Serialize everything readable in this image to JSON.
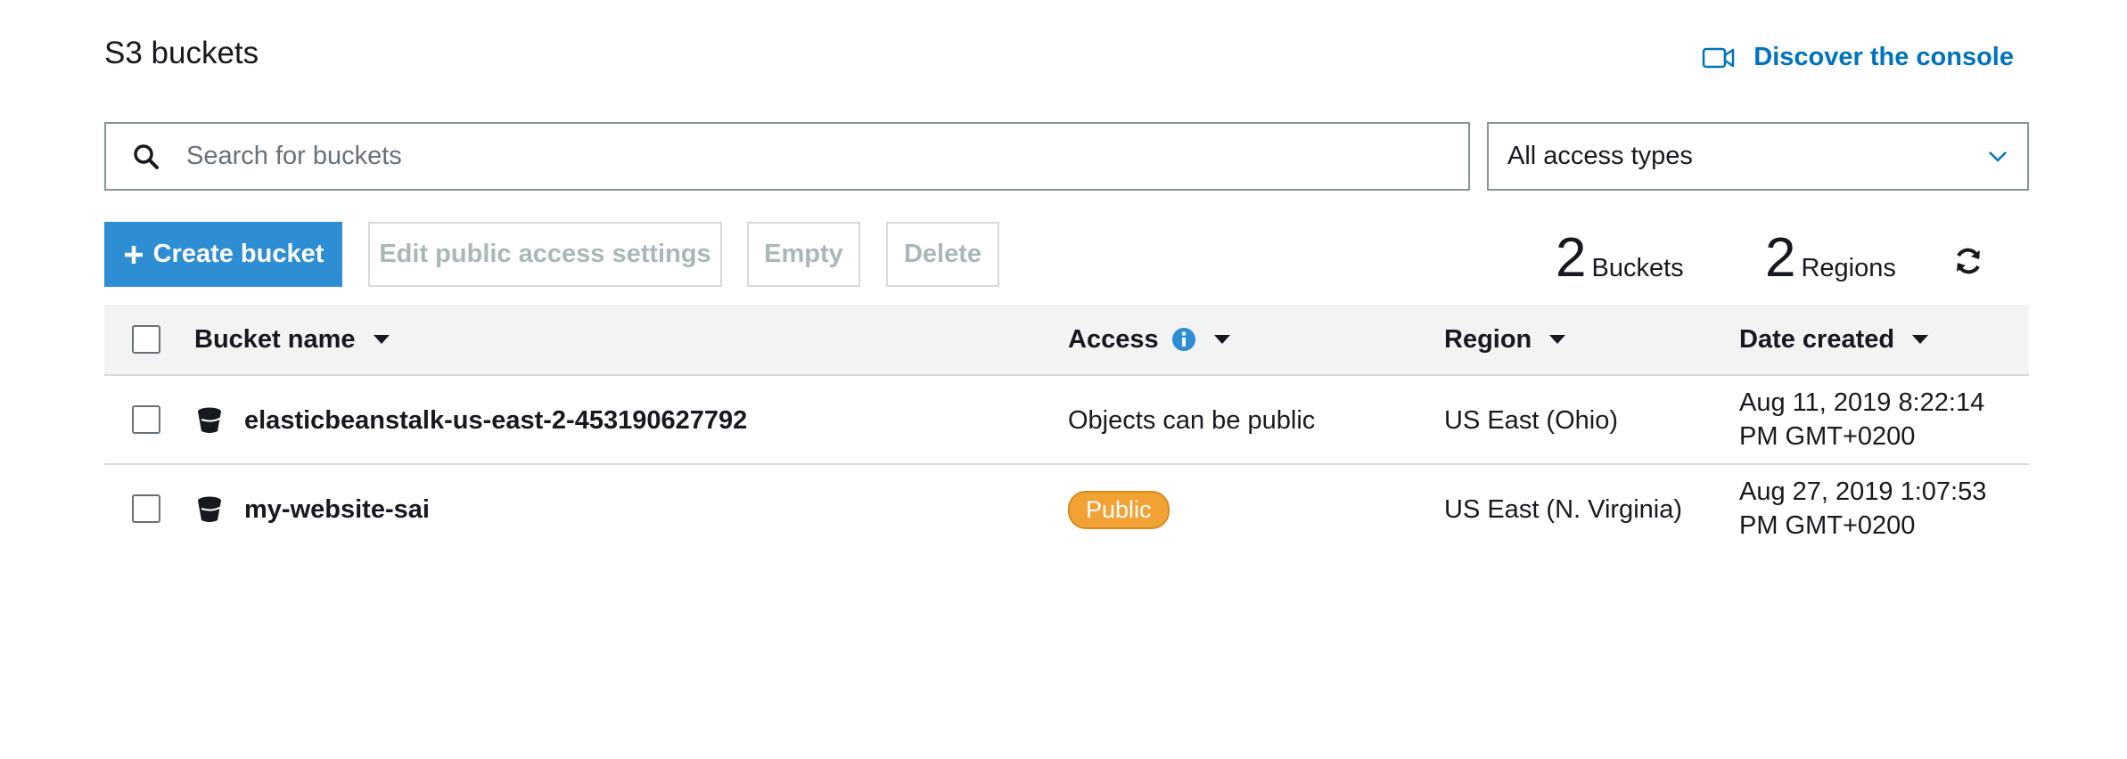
{
  "header": {
    "title": "S3 buckets",
    "discover_label": "Discover the console",
    "discover_icon": "video-camera-icon"
  },
  "search": {
    "placeholder": "Search for buckets",
    "value": ""
  },
  "access_filter": {
    "selected": "All access types"
  },
  "toolbar": {
    "create_label": "Create bucket",
    "edit_label": "Edit public access settings",
    "empty_label": "Empty",
    "delete_label": "Delete"
  },
  "summary": {
    "buckets_count": "2",
    "buckets_label": "Buckets",
    "regions_count": "2",
    "regions_label": "Regions"
  },
  "table": {
    "columns": [
      {
        "label": "Bucket name"
      },
      {
        "label": "Access"
      },
      {
        "label": "Region"
      },
      {
        "label": "Date created"
      }
    ],
    "rows": [
      {
        "name": "elasticbeanstalk-us-east-2-453190627792",
        "access": "Objects can be public",
        "region": "US East (Ohio)",
        "date_line1": "Aug 11, 2019 8:22:14",
        "date_line2": "PM GMT+0200"
      },
      {
        "name": "my-website-sai",
        "access": "Public",
        "region": "US East (N. Virginia)",
        "date_line1": "Aug 27, 2019 1:07:53",
        "date_line2": "PM GMT+0200"
      }
    ]
  },
  "colors": {
    "accent": "#0073bb",
    "primary_button": "#2e8ed3",
    "public_badge": "#f2a235",
    "header_bg": "#f2f3f3"
  }
}
